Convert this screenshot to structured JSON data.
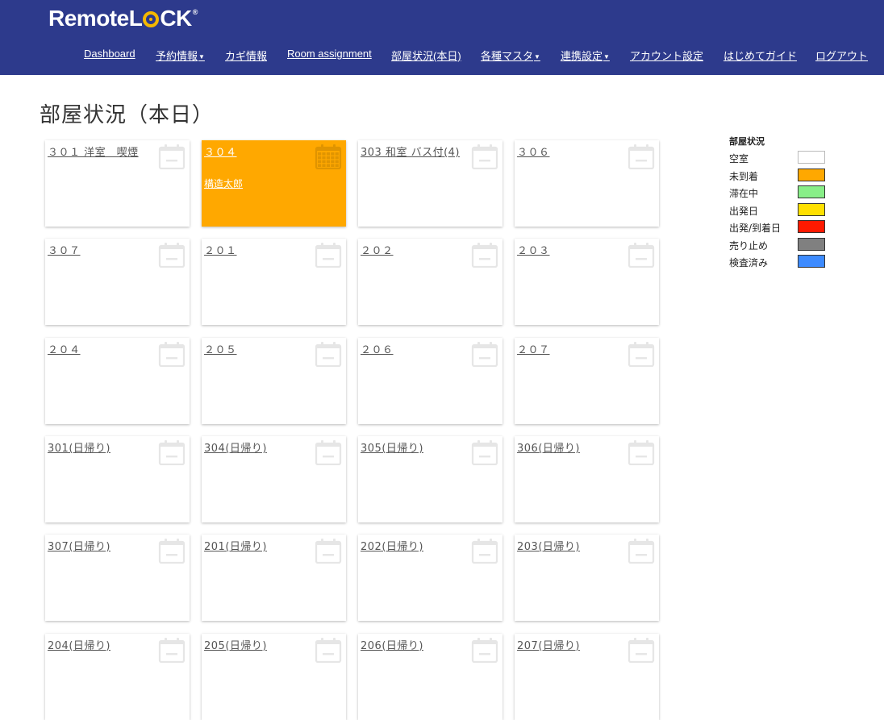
{
  "app": {
    "brand_left": "Remote",
    "brand_right_l": "L",
    "brand_right_ck": "CK",
    "brand_tm": "®"
  },
  "nav": [
    {
      "label": "Dashboard",
      "dropdown": false
    },
    {
      "label": "予約情報",
      "dropdown": true
    },
    {
      "label": "カギ情報",
      "dropdown": false
    },
    {
      "label": "Room assignment",
      "dropdown": false
    },
    {
      "label": "部屋状況(本日)",
      "dropdown": false
    },
    {
      "label": "各種マスタ",
      "dropdown": true
    },
    {
      "label": "連携設定",
      "dropdown": true
    },
    {
      "label": "アカウント設定",
      "dropdown": false
    },
    {
      "label": "はじめてガイド",
      "dropdown": false
    },
    {
      "label": "ログアウト",
      "dropdown": false
    }
  ],
  "page_title": "部屋状況（本日）",
  "rooms": [
    {
      "name": "３０１ 洋室　喫煙",
      "status": "vacant"
    },
    {
      "name": "３０４",
      "status": "not_arrived",
      "guest": "構造太郎"
    },
    {
      "name": "303 和室 バス付(4)",
      "status": "vacant"
    },
    {
      "name": "３０６",
      "status": "vacant"
    },
    {
      "name": "３０７",
      "status": "vacant"
    },
    {
      "name": "２０１",
      "status": "vacant"
    },
    {
      "name": "２０２",
      "status": "vacant"
    },
    {
      "name": "２０３",
      "status": "vacant"
    },
    {
      "name": "２０４",
      "status": "vacant"
    },
    {
      "name": "２０５",
      "status": "vacant"
    },
    {
      "name": "２０６",
      "status": "vacant"
    },
    {
      "name": "２０７",
      "status": "vacant"
    },
    {
      "name": "301(日帰り)",
      "status": "vacant"
    },
    {
      "name": "304(日帰り)",
      "status": "vacant"
    },
    {
      "name": "305(日帰り)",
      "status": "vacant"
    },
    {
      "name": "306(日帰り)",
      "status": "vacant"
    },
    {
      "name": "307(日帰り)",
      "status": "vacant"
    },
    {
      "name": "201(日帰り)",
      "status": "vacant"
    },
    {
      "name": "202(日帰り)",
      "status": "vacant"
    },
    {
      "name": "203(日帰り)",
      "status": "vacant"
    },
    {
      "name": "204(日帰り)",
      "status": "vacant"
    },
    {
      "name": "205(日帰り)",
      "status": "vacant"
    },
    {
      "name": "206(日帰り)",
      "status": "vacant"
    },
    {
      "name": "207(日帰り)",
      "status": "vacant"
    }
  ],
  "legend": {
    "title": "部屋状況",
    "items": [
      {
        "label": "空室",
        "color": "#ffffff"
      },
      {
        "label": "未到着",
        "color": "#ffa800"
      },
      {
        "label": "滞在中",
        "color": "#88ee88"
      },
      {
        "label": "出発日",
        "color": "#ffe000"
      },
      {
        "label": "出発/到着日",
        "color": "#ff1a00"
      },
      {
        "label": "売り止め",
        "color": "#808080"
      },
      {
        "label": "検査済み",
        "color": "#3d8bff"
      }
    ]
  },
  "colors": {
    "navbar": "#2d3a8c",
    "accent": "#f5b800",
    "occupied": "#ffa800"
  }
}
